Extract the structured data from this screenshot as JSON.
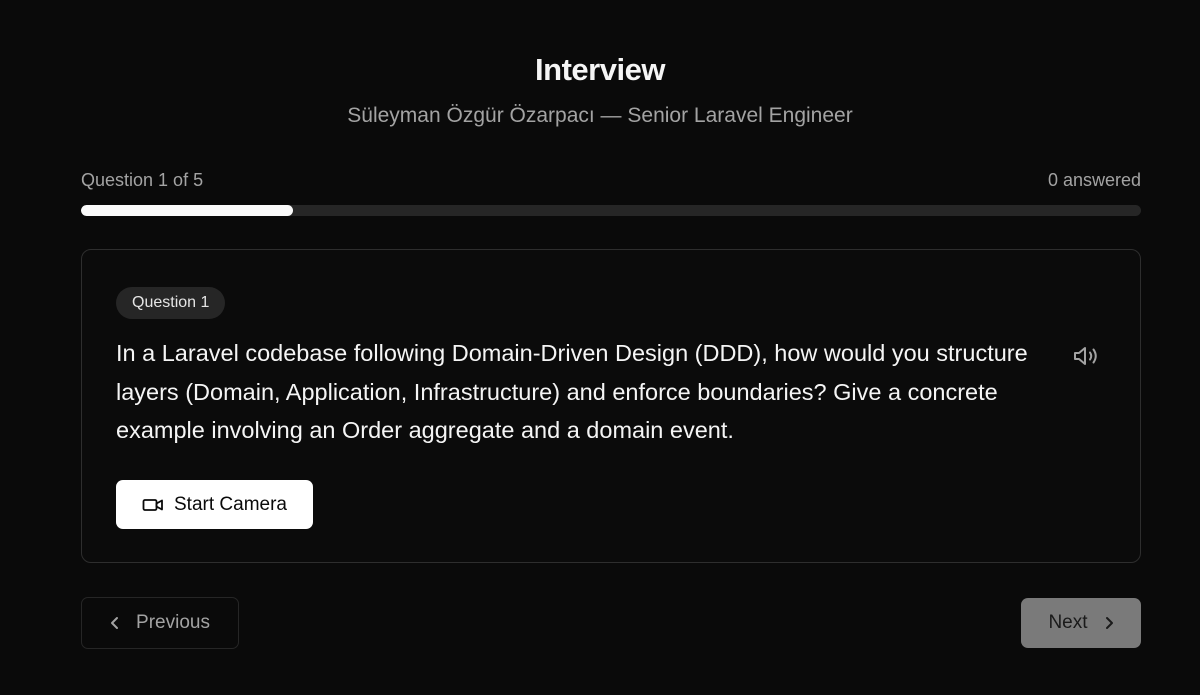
{
  "header": {
    "title": "Interview",
    "subtitle": "Süleyman Özgür Özarpacı — Senior Laravel Engineer"
  },
  "progress": {
    "label": "Question 1 of 5",
    "answered": "0 answered",
    "fraction": 0.2
  },
  "question": {
    "badge": "Question 1",
    "text": "In a Laravel codebase following Domain-Driven Design (DDD), how would you structure layers (Domain, Application, Infrastructure) and enforce boundaries? Give a concrete example involving an Order aggregate and a domain event.",
    "speaker_icon": "volume-icon",
    "camera_button": "Start Camera",
    "camera_icon": "video-camera-icon"
  },
  "navigation": {
    "previous": "Previous",
    "next": "Next",
    "previous_icon": "chevron-left-icon",
    "next_icon": "chevron-right-icon"
  },
  "colors": {
    "background": "#0a0a0a",
    "progress_fill": "#fafafa",
    "progress_track": "#262626",
    "next_button": "#7a7a7a"
  }
}
